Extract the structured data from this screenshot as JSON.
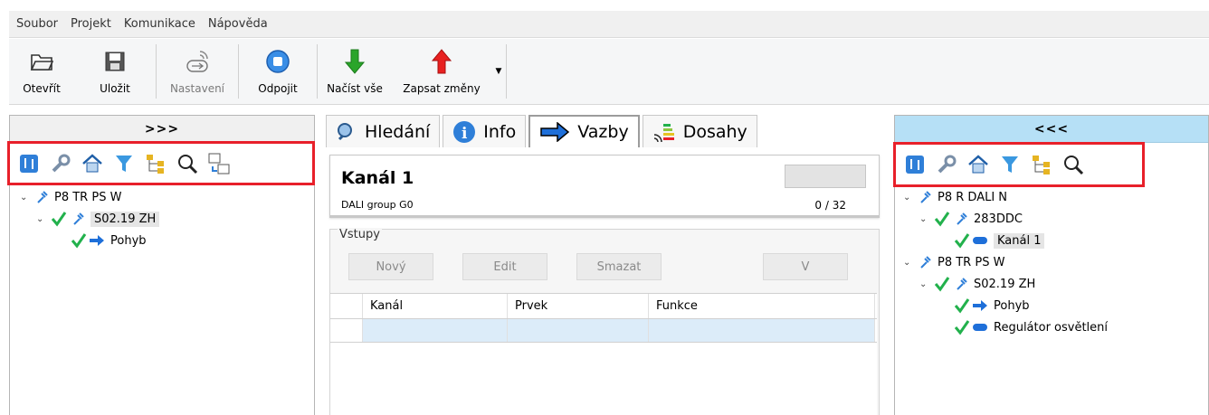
{
  "menu": [
    "Soubor",
    "Projekt",
    "Komunikace",
    "Nápověda"
  ],
  "toolbar": {
    "open": "Otevřít",
    "save": "Uložit",
    "settings": "Nastavení",
    "disconnect": "Odpojit",
    "load_all": "Načíst vše",
    "write_changes": "Zapsat změny"
  },
  "left_panel": {
    "header": ">>>",
    "tree": {
      "root": "P8 TR PS W",
      "child": "S02.19 ZH",
      "leaf": "Pohyb"
    }
  },
  "right_panel": {
    "header": "<<<",
    "tree": {
      "root1": "P8 R DALI N",
      "root1_child": "283DDC",
      "root1_leaf": "Kanál 1",
      "root2": "P8 TR PS W",
      "root2_child": "S02.19 ZH",
      "root2_leaf1": "Pohyb",
      "root2_leaf2": "Regulátor osvětlení"
    }
  },
  "tabs": [
    "Hledání",
    "Info",
    "Vazby",
    "Dosahy"
  ],
  "detail": {
    "title": "Kanál 1",
    "subtitle": "DALI group G0",
    "counter": "0 / 32"
  },
  "inputs_group": {
    "legend": "Vstupy",
    "buttons": {
      "new": "Nový",
      "edit": "Edit",
      "delete": "Smazat",
      "v": "V"
    },
    "columns": [
      "Kanál",
      "Prvek",
      "Funkce"
    ]
  },
  "colors": {
    "highlight_border": "#e8202a",
    "right_header": "#b6e0f6",
    "check_green": "#22b14c",
    "arrow_blue": "#1e6fd9"
  }
}
